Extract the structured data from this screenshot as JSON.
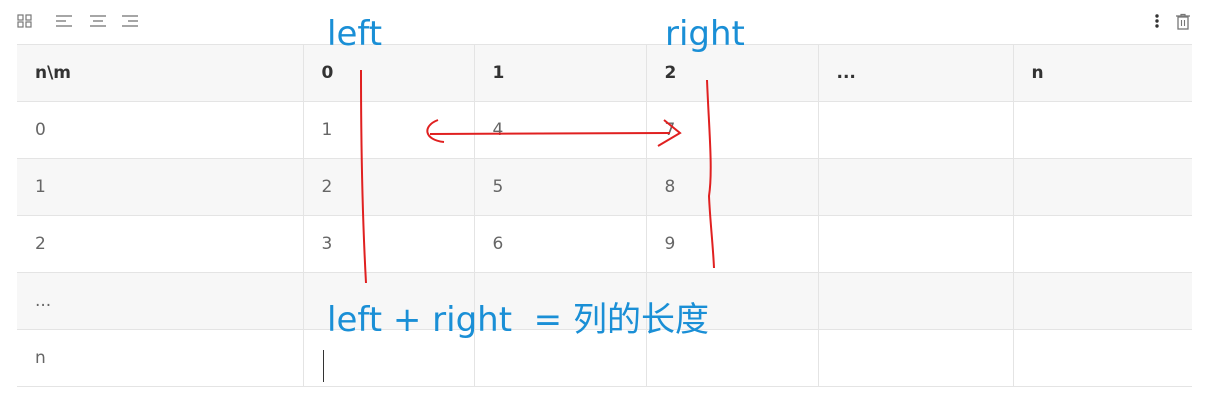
{
  "toolbar": {
    "icons": [
      "grid-icon",
      "align-left-icon",
      "align-center-icon",
      "align-right-icon",
      "more-vertical-icon",
      "trash-icon"
    ]
  },
  "table": {
    "headers": [
      "n\\m",
      "0",
      "1",
      "2",
      "...",
      "n"
    ],
    "rows": [
      [
        "0",
        "1",
        "4",
        "7",
        "",
        ""
      ],
      [
        "1",
        "2",
        "5",
        "8",
        "",
        ""
      ],
      [
        "2",
        "3",
        "6",
        "9",
        "",
        ""
      ],
      [
        "...",
        "",
        "",
        "",
        "",
        ""
      ],
      [
        "n",
        "",
        "",
        "",
        "",
        ""
      ]
    ]
  },
  "annotations": {
    "left_label": "left",
    "right_label": "right",
    "formula": "left + right  = 列的长度"
  },
  "colors": {
    "annotation_text": "#1a8fd6",
    "annotation_ink": "#e02020"
  }
}
